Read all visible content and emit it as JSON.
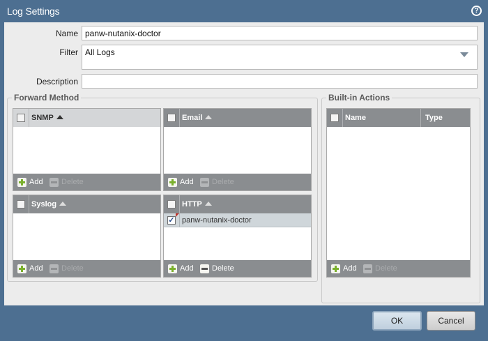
{
  "dialog": {
    "title": "Log Settings",
    "help_icon": "?"
  },
  "form": {
    "name_label": "Name",
    "name_value": "panw-nutanix-doctor",
    "filter_label": "Filter",
    "filter_value": "All Logs",
    "description_label": "Description",
    "description_value": ""
  },
  "forward_method": {
    "title": "Forward Method",
    "snmp": {
      "header": "SNMP",
      "add": "Add",
      "delete": "Delete"
    },
    "email": {
      "header": "Email",
      "add": "Add",
      "delete": "Delete"
    },
    "syslog": {
      "header": "Syslog",
      "add": "Add",
      "delete": "Delete"
    },
    "http": {
      "header": "HTTP",
      "add": "Add",
      "delete": "Delete",
      "rows": [
        {
          "label": "panw-nutanix-doctor",
          "checked": true
        }
      ]
    }
  },
  "builtin_actions": {
    "title": "Built-in Actions",
    "columns": [
      "Name",
      "Type"
    ],
    "add": "Add",
    "delete": "Delete"
  },
  "buttons": {
    "ok": "OK",
    "cancel": "Cancel"
  },
  "colors": {
    "titlebar": "#4d6f91",
    "panel_header": "#8a8d90",
    "selected_row": "#cfd6da",
    "add_green": "#7ab02c"
  }
}
